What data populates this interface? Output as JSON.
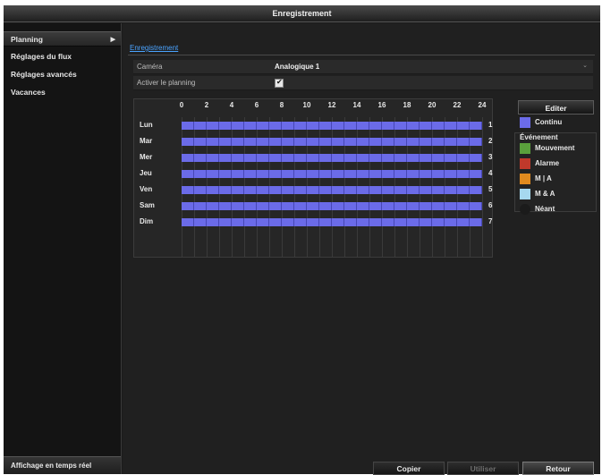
{
  "window": {
    "title": "Enregistrement"
  },
  "sidebar": {
    "items": [
      {
        "label": "Planning",
        "active": true
      },
      {
        "label": "Réglages du flux"
      },
      {
        "label": "Réglages avancés"
      },
      {
        "label": "Vacances"
      }
    ],
    "footer": "Affichage en temps réel"
  },
  "tab": {
    "label": "Enregistrement"
  },
  "form": {
    "camera_label": "Caméra",
    "camera_value": "Analogique 1",
    "planning_label": "Activer le planning",
    "planning_checked": true
  },
  "schedule": {
    "hours": [
      "0",
      "2",
      "4",
      "6",
      "8",
      "10",
      "12",
      "14",
      "16",
      "18",
      "20",
      "22",
      "24"
    ],
    "days": [
      {
        "name": "Lun",
        "num": "1"
      },
      {
        "name": "Mar",
        "num": "2"
      },
      {
        "name": "Mer",
        "num": "3"
      },
      {
        "name": "Jeu",
        "num": "4"
      },
      {
        "name": "Ven",
        "num": "5"
      },
      {
        "name": "Sam",
        "num": "6"
      },
      {
        "name": "Dim",
        "num": "7"
      }
    ],
    "fill_mode": "Continu",
    "fill_color": "#6b6be8"
  },
  "legend": {
    "edit_label": "Editer",
    "continu": {
      "label": "Continu",
      "color": "#6b6be8"
    },
    "event_title": "Événement",
    "mouvement": {
      "label": "Mouvement",
      "color": "#5aa03c"
    },
    "alarme": {
      "label": "Alarme",
      "color": "#c0392b"
    },
    "m_or_a": {
      "label": "M | A",
      "color": "#e08a1e"
    },
    "m_and_a": {
      "label": "M & A",
      "color": "#a6d8ef"
    },
    "neant": {
      "label": "Néant",
      "color": "#1b1b1b"
    }
  },
  "footer": {
    "copy": "Copier",
    "apply": "Utiliser",
    "back": "Retour"
  }
}
